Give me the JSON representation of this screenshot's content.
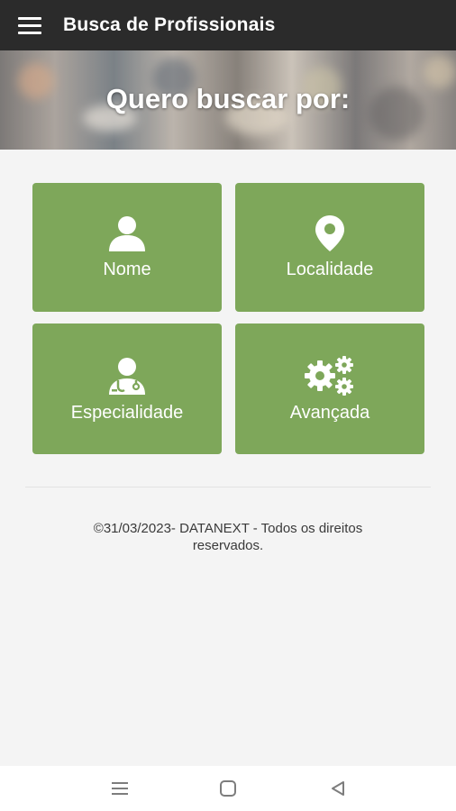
{
  "appbar": {
    "title": "Busca de Profissionais",
    "menu_icon": "hamburger-menu-icon"
  },
  "hero": {
    "title": "Quero buscar por:"
  },
  "options": [
    {
      "label": "Nome",
      "icon": "user-icon"
    },
    {
      "label": "Localidade",
      "icon": "map-pin-icon"
    },
    {
      "label": "Especialidade",
      "icon": "doctor-stethoscope-icon"
    },
    {
      "label": "Avançada",
      "icon": "gears-icon"
    }
  ],
  "footer": {
    "line1": "©31/03/2023- DATANEXT - Todos os direitos",
    "line2": "reservados."
  },
  "system_nav": {
    "recents_icon": "recents-icon",
    "home_icon": "home-icon",
    "back_icon": "back-icon"
  },
  "colors": {
    "appbar": "#2b2b2b",
    "tile": "#7ea75a",
    "background": "#f4f4f4"
  }
}
